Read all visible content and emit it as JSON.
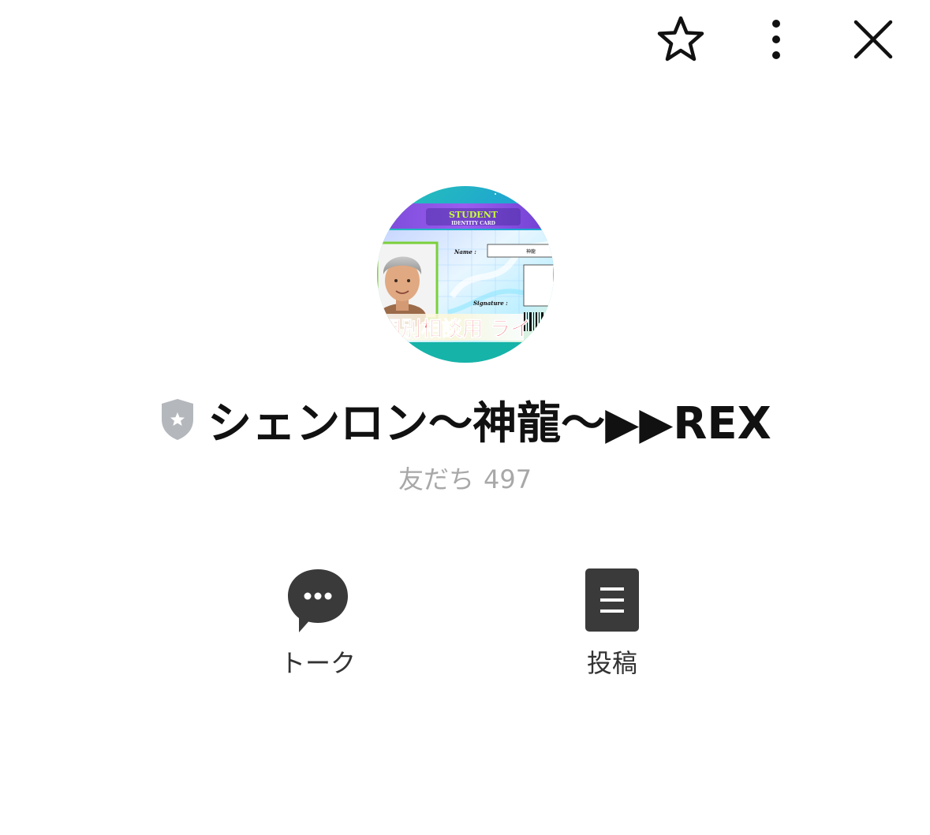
{
  "topbar": {
    "favorite_icon": "star-outline-icon",
    "more_icon": "vertical-dots-icon",
    "close_icon": "close-x-icon"
  },
  "profile": {
    "avatar": {
      "card_title": "STUDENT",
      "card_subtitle": "IDENTITY CARD",
      "name_field_label": "Name :",
      "name_field_value": "神龍",
      "signature_label": "Signature :",
      "banner_text": "個別相談用 ライ"
    },
    "badge_icon": "gray-shield-star-icon",
    "name": "シェンロン〜神龍〜▶︎▶︎REX",
    "friends_label": "友だち",
    "friends_count": "497"
  },
  "actions": [
    {
      "label": "トーク",
      "icon": "chat-bubble-icon"
    },
    {
      "label": "投稿",
      "icon": "post-list-icon"
    }
  ],
  "colors": {
    "text_primary": "#111111",
    "text_secondary": "#a8a8a8",
    "icon_dark": "#3a3a3a",
    "badge_gray": "#b4b8bd"
  }
}
